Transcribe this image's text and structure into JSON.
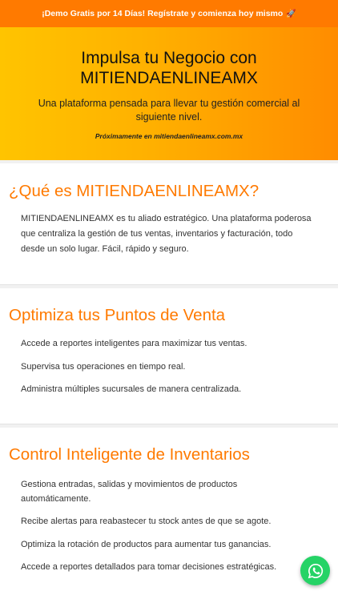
{
  "promo": {
    "text": "¡Demo Gratis por 14 Días! Regístrate y comienza hoy mismo",
    "icon": "rocket-icon"
  },
  "hero": {
    "title": "Impulsa tu Negocio con MITIENDAENLINEAMX",
    "subtitle": "Una plataforma pensada para llevar tu gestión comercial al siguiente nivel.",
    "soon": "Próximamente en mitiendaenlineamx.com.mx"
  },
  "about": {
    "heading": "¿Qué es MITIENDAENLINEAMX?",
    "text": "MITIENDAENLINEAMX es tu aliado estratégico. Una plataforma poderosa que centraliza la gestión de tus ventas, inventarios y facturación, todo desde un solo lugar. Fácil, rápido y seguro."
  },
  "pos": {
    "heading": "Optimiza tus Puntos de Venta",
    "items": [
      "Accede a reportes inteligentes para maximizar tus ventas.",
      "Supervisa tus operaciones en tiempo real.",
      "Administra múltiples sucursales de manera centralizada."
    ]
  },
  "inventory": {
    "heading": "Control Inteligente de Inventarios",
    "items": [
      "Gestiona entradas, salidas y movimientos de productos automáticamente.",
      "Recibe alertas para reabastecer tu stock antes de que se agote.",
      "Optimiza la rotación de productos para aumentar tus ganancias.",
      "Accede a reportes detallados para tomar decisiones estratégicas."
    ]
  },
  "whatsapp": {
    "icon": "whatsapp-icon"
  },
  "colors": {
    "accent": "#ff7a00",
    "whatsapp": "#25d366"
  }
}
